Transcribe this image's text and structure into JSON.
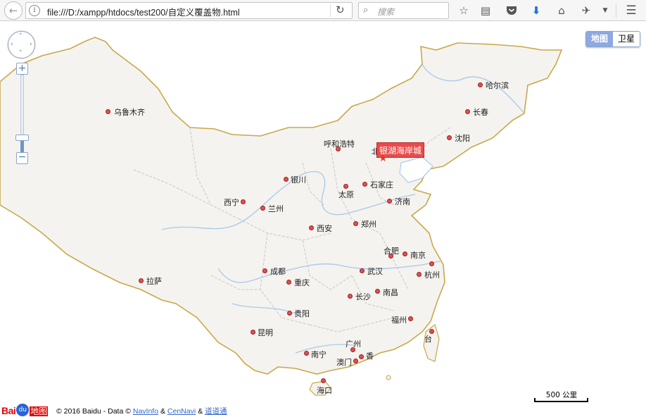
{
  "browser": {
    "url": "file:///D:/xampp/htdocs/test200/自定义覆盖物.html",
    "search_placeholder": "搜索",
    "icons": [
      "back-arrow-icon",
      "info-icon",
      "reload-icon",
      "search-icon",
      "bookmark-star-icon",
      "reading-list-icon",
      "pocket-icon",
      "download-icon",
      "home-icon",
      "extension-icon",
      "dropdown-icon",
      "menu-icon"
    ]
  },
  "map": {
    "map_type": {
      "active": "地图",
      "inactive": "卫星"
    },
    "marker": {
      "label": "银湖海岸城",
      "icon": "star-marker-icon"
    },
    "cities": [
      {
        "name": "乌鲁木齐"
      },
      {
        "name": "哈尔滨"
      },
      {
        "name": "长春"
      },
      {
        "name": "沈阳"
      },
      {
        "name": "呼和浩特"
      },
      {
        "name": "北"
      },
      {
        "name": "银川"
      },
      {
        "name": "太原"
      },
      {
        "name": "石家庄"
      },
      {
        "name": "西宁"
      },
      {
        "name": "兰州"
      },
      {
        "name": "济南"
      },
      {
        "name": "西安"
      },
      {
        "name": "郑州"
      },
      {
        "name": "合肥"
      },
      {
        "name": "南京"
      },
      {
        "name": "成都"
      },
      {
        "name": "武汉"
      },
      {
        "name": "杭州"
      },
      {
        "name": "拉萨"
      },
      {
        "name": "重庆"
      },
      {
        "name": "长沙"
      },
      {
        "name": "南昌"
      },
      {
        "name": "贵阳"
      },
      {
        "name": "福州"
      },
      {
        "name": "昆明"
      },
      {
        "name": "台"
      },
      {
        "name": "南宁"
      },
      {
        "name": "广州"
      },
      {
        "name": "澳门"
      },
      {
        "name": "香"
      },
      {
        "name": "海口"
      }
    ],
    "scale": "500 公里",
    "copyright": {
      "logo": "Bai地图",
      "text": "© 2016 Baidu - Data ©",
      "links": [
        "NavInfo",
        "CenNavi",
        "道道通"
      ],
      "separator": "&"
    }
  }
}
